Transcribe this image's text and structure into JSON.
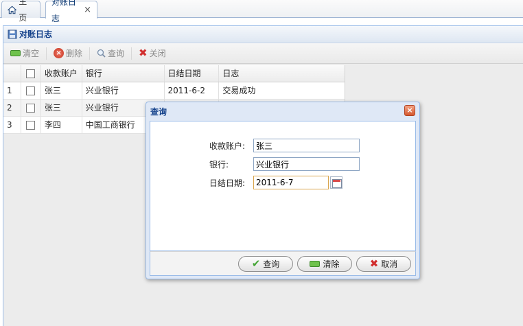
{
  "tabs": [
    {
      "label": "主页"
    },
    {
      "label": "对账日志",
      "close": "×"
    }
  ],
  "panel": {
    "title": "对账日志"
  },
  "toolbar": {
    "clear": "清空",
    "delete": "删除",
    "query": "查询",
    "close": "关闭"
  },
  "grid": {
    "headers": {
      "account": "收款账户",
      "bank": "银行",
      "date": "日结日期",
      "log": "日志"
    },
    "rows": [
      {
        "num": "1",
        "account": "张三",
        "bank": "兴业银行",
        "date": "2011-6-2",
        "log": "交易成功"
      },
      {
        "num": "2",
        "account": "张三",
        "bank": "兴业银行",
        "date": "",
        "log": ""
      },
      {
        "num": "3",
        "account": "李四",
        "bank": "中国工商银行",
        "date": "",
        "log": ""
      }
    ]
  },
  "dialog": {
    "title": "查询",
    "fields": {
      "account": {
        "label": "收款账户:",
        "value": "张三"
      },
      "bank": {
        "label": "银行:",
        "value": "兴业银行"
      },
      "date": {
        "label": "日结日期:",
        "value": "2011-6-7"
      }
    },
    "buttons": {
      "query": "查询",
      "clear": "清除",
      "cancel": "取消"
    }
  },
  "colors": {
    "accent": "#15428b",
    "border": "#99bbe8",
    "dialog_bg": "#dfe8f6"
  }
}
